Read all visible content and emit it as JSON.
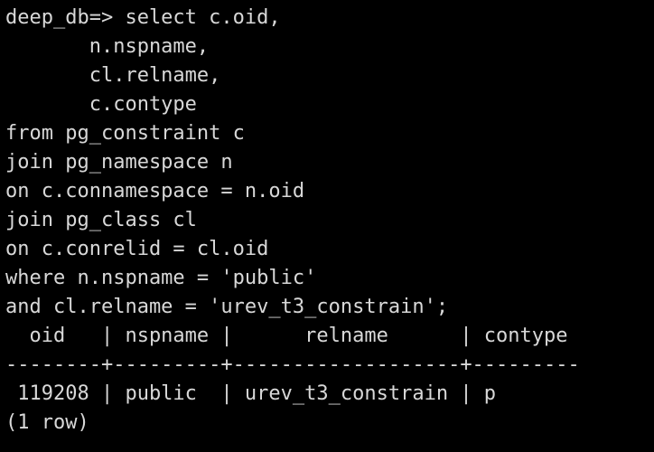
{
  "terminal": {
    "lines": [
      "deep_db=> select c.oid,",
      "       n.nspname,",
      "       cl.relname,",
      "       c.contype",
      "from pg_constraint c",
      "join pg_namespace n",
      "on c.connamespace = n.oid",
      "join pg_class cl",
      "on c.conrelid = cl.oid",
      "where n.nspname = 'public'",
      "and cl.relname = 'urev_t3_constrain';",
      "  oid   | nspname |      relname      | contype",
      "--------+---------+-------------------+---------",
      " 119208 | public  | urev_t3_constrain | p",
      "(1 row)"
    ]
  }
}
